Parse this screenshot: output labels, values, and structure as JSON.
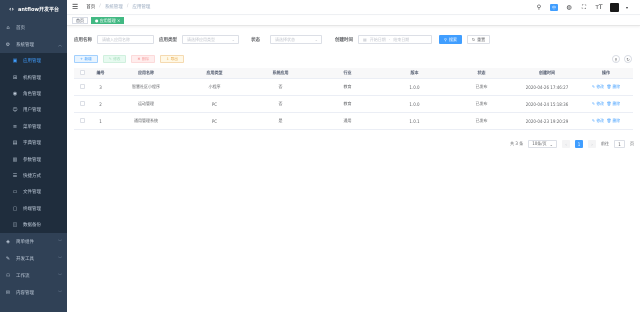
{
  "app": {
    "title": "antflow开发平台"
  },
  "sidebar": {
    "items": [
      {
        "label": "首页",
        "icon": "home-icon"
      },
      {
        "label": "系统管理",
        "icon": "gear-icon",
        "expanded": true
      }
    ],
    "sub_items": [
      {
        "label": "应用管理",
        "active": true
      },
      {
        "label": "机构管理"
      },
      {
        "label": "角色管理"
      },
      {
        "label": "用户管理"
      },
      {
        "label": "菜单管理"
      },
      {
        "label": "字典管理"
      },
      {
        "label": "参数管理"
      },
      {
        "label": "快捷方式"
      },
      {
        "label": "文件管理"
      },
      {
        "label": "终端管理"
      },
      {
        "label": "数据备份"
      }
    ],
    "bottom_items": [
      {
        "label": "简单组件"
      },
      {
        "label": "开发工具"
      },
      {
        "label": "工作流"
      },
      {
        "label": "内容管理"
      }
    ]
  },
  "header": {
    "breadcrumb": [
      "首页",
      "系统管理",
      "应用管理"
    ],
    "badge": "中",
    "icons": [
      "search-icon",
      "language-icon",
      "github-icon",
      "fullscreen-icon",
      "font-size-icon",
      "avatar"
    ]
  },
  "tags": [
    {
      "label": "首页",
      "active": false
    },
    {
      "label": "应用管理",
      "active": true,
      "close": "×"
    }
  ],
  "search": {
    "app_name_label": "应用名称",
    "app_name_placeholder": "请输入应用名称",
    "app_type_label": "应用类型",
    "app_type_placeholder": "请选择应用类型",
    "status_label": "状态",
    "status_placeholder": "请选择状态",
    "created_label": "创建时间",
    "start_placeholder": "开始日期",
    "range_sep": "-",
    "end_placeholder": "结束日期",
    "search_btn": "搜索",
    "reset_btn": "重置"
  },
  "actions": {
    "add": "新增",
    "edit": "修改",
    "delete": "删除",
    "export": "导出"
  },
  "table": {
    "headers": [
      "编号",
      "应用名称",
      "应用类型",
      "系统应用",
      "行业",
      "版本",
      "状态",
      "创建时间",
      "操作"
    ],
    "rows": [
      {
        "id": "3",
        "name": "智慧社区小程序",
        "type": "小程序",
        "system": "否",
        "industry": "教育",
        "version": "1.0.0",
        "status": "已发布",
        "created": "2020-04-26 17:46:27",
        "edit": "修改",
        "del": "删除"
      },
      {
        "id": "2",
        "name": "运动管理",
        "type": "PC",
        "system": "否",
        "industry": "教育",
        "version": "1.0.0",
        "status": "已发布",
        "created": "2020-04-24 15:18:36",
        "edit": "修改",
        "del": "删除"
      },
      {
        "id": "1",
        "name": "通用管理系统",
        "type": "PC",
        "system": "是",
        "industry": "通用",
        "version": "1.0.1",
        "status": "已发布",
        "created": "2020-04-23 19:20:29",
        "edit": "修改",
        "del": "删除"
      }
    ]
  },
  "pagination": {
    "total": "共 3 条",
    "page_size": "10条/页",
    "current": "1",
    "goto_label": "前往",
    "goto_value": "1",
    "page_suffix": "页"
  },
  "colors": {
    "sidebar_bg": "#304156",
    "primary": "#409eff",
    "tag_active": "#42b983"
  }
}
